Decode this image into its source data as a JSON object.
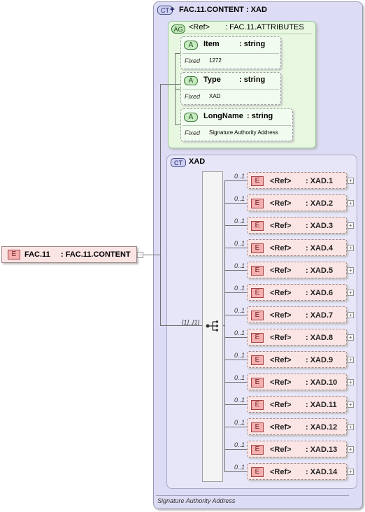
{
  "root": {
    "badge": "E",
    "name": "FAC.11",
    "type": ": FAC.11.CONTENT",
    "expander": "−"
  },
  "complex_type": {
    "badge": "CT",
    "title": "FAC.11.CONTENT : XAD",
    "documentation": "Signature Authority Address"
  },
  "attribute_group": {
    "badge": "AG",
    "ref": "<Ref>",
    "name": ": FAC.11.ATTRIBUTES",
    "attributes": [
      {
        "badge": "A",
        "name": "Item",
        "type": ": string",
        "fixed_label": "Fixed",
        "fixed_value": "1272"
      },
      {
        "badge": "A",
        "name": "Type",
        "type": ": string",
        "fixed_label": "Fixed",
        "fixed_value": "XAD"
      },
      {
        "badge": "A",
        "name": "LongName",
        "type": ": string",
        "fixed_label": "Fixed",
        "fixed_value": "Signature Authority Address"
      }
    ]
  },
  "base_type": {
    "badge": "CT",
    "name": "XAD",
    "sequence_occurrence": "[1]..[1]",
    "elements": [
      {
        "badge": "E",
        "ref": "<Ref>",
        "name": ": XAD.1",
        "occurrence": "0..1",
        "expander": "+"
      },
      {
        "badge": "E",
        "ref": "<Ref>",
        "name": ": XAD.2",
        "occurrence": "0..1",
        "expander": "+"
      },
      {
        "badge": "E",
        "ref": "<Ref>",
        "name": ": XAD.3",
        "occurrence": "0..1",
        "expander": "+"
      },
      {
        "badge": "E",
        "ref": "<Ref>",
        "name": ": XAD.4",
        "occurrence": "0..1",
        "expander": "+"
      },
      {
        "badge": "E",
        "ref": "<Ref>",
        "name": ": XAD.5",
        "occurrence": "0..1",
        "expander": "+"
      },
      {
        "badge": "E",
        "ref": "<Ref>",
        "name": ": XAD.6",
        "occurrence": "0..1",
        "expander": "+"
      },
      {
        "badge": "E",
        "ref": "<Ref>",
        "name": ": XAD.7",
        "occurrence": "0..1",
        "expander": "+"
      },
      {
        "badge": "E",
        "ref": "<Ref>",
        "name": ": XAD.8",
        "occurrence": "0..1",
        "expander": "+"
      },
      {
        "badge": "E",
        "ref": "<Ref>",
        "name": ": XAD.9",
        "occurrence": "0..1",
        "expander": "+"
      },
      {
        "badge": "E",
        "ref": "<Ref>",
        "name": ": XAD.10",
        "occurrence": "0..1",
        "expander": "+"
      },
      {
        "badge": "E",
        "ref": "<Ref>",
        "name": ": XAD.11",
        "occurrence": "0..1",
        "expander": "+"
      },
      {
        "badge": "E",
        "ref": "<Ref>",
        "name": ": XAD.12",
        "occurrence": "0..1",
        "expander": "+"
      },
      {
        "badge": "E",
        "ref": "<Ref>",
        "name": ": XAD.13",
        "occurrence": "0..1",
        "expander": "+"
      },
      {
        "badge": "E",
        "ref": "<Ref>",
        "name": ": XAD.14",
        "occurrence": "0..1",
        "expander": "+"
      }
    ]
  }
}
